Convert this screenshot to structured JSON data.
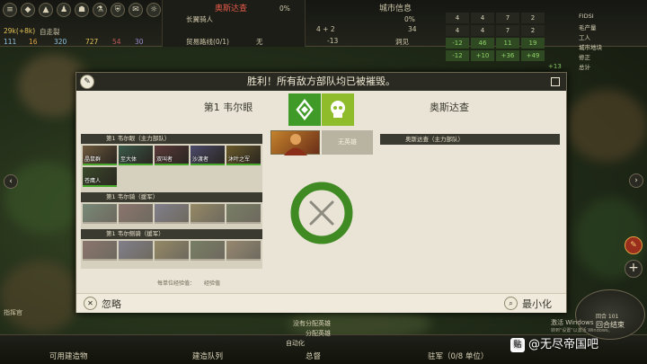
{
  "hud": {
    "center_title": "奥斯达查",
    "city_info_title": "城市信息",
    "resources": {
      "money": "29k(+8k)",
      "money_sub": "自走裂",
      "line1": "111",
      "line2": "16",
      "line3": "320",
      "line4": "727",
      "line5": "54",
      "line6": "30"
    },
    "center_row1": "长翼骑人",
    "center_row2": "贸易路线(0/1)",
    "center_row3": "无",
    "center_pct": "0%",
    "right_num1": "4 + 2",
    "right_num2": "-13",
    "right_pct": "0%",
    "right_num3": "34",
    "right_text": "洞见",
    "right_panel_items": [
      "FIDSI",
      "毛产量",
      "工人",
      "城市地块",
      "修正",
      "总计"
    ],
    "grid_values": [
      "4",
      "4",
      "7",
      "2",
      "4",
      "4",
      "7",
      "2",
      "-12",
      "46",
      "11",
      "19",
      "-12",
      "+10",
      "+36",
      "+49"
    ],
    "grid_extra": "+13"
  },
  "panel": {
    "title": "胜利！所有敌方部队均已被摧毁。",
    "left_name": "第1 韦尔眼",
    "right_name": "奥斯达查",
    "no_hero": "无英雄",
    "enemy_army_header": "奥斯达查（主力部队）",
    "groups": [
      {
        "header": "第1 韦尔眼（主力部队）",
        "cards": [
          "晶鼠群",
          "至大体",
          "双叫者",
          "沙渡者",
          "沐叶之军",
          "苍鹰人"
        ]
      },
      {
        "header": "第1 韦尔骑（援军）",
        "cards": [
          "",
          "",
          "",
          "",
          ""
        ]
      },
      {
        "header": "第1 韦尔侧骑（援军）",
        "cards": [
          "",
          "",
          "",
          "",
          ""
        ]
      }
    ],
    "exp_label": "每单位经验值：",
    "exp_value": "经验值",
    "ignore_label": "忽略",
    "minimize_label": "最小化",
    "ring_fill": 1.0
  },
  "bottom": {
    "available_buildings": "可用建造物",
    "build_queue": "建造队列",
    "overview": "总督",
    "garrison": "驻军（0/8 单位）",
    "no_hero_assigned": "没有分配英雄",
    "assign_hero": "分配英雄",
    "auto": "自动化",
    "end_turn": "回合结束",
    "turn_no": "回合 101",
    "activate_windows": "激活 Windows",
    "activate_sub": "转到\"设置\"以激活 Windows。",
    "left_label": "指挥官",
    "watermark": "@无尽帝国吧"
  },
  "colors": {
    "accent_green": "#3f9a27",
    "skull_green": "#8fbc2a",
    "panel_bg": "#e9e4d5",
    "titlebar": "#2a2922"
  },
  "icons": {
    "edit": "pencil-icon",
    "close": "close-icon",
    "search": "magnifier-icon",
    "minimize": "square-icon",
    "victory": "laurel-icon",
    "skull": "skull-icon",
    "battle": "crossed-swords-icon"
  }
}
